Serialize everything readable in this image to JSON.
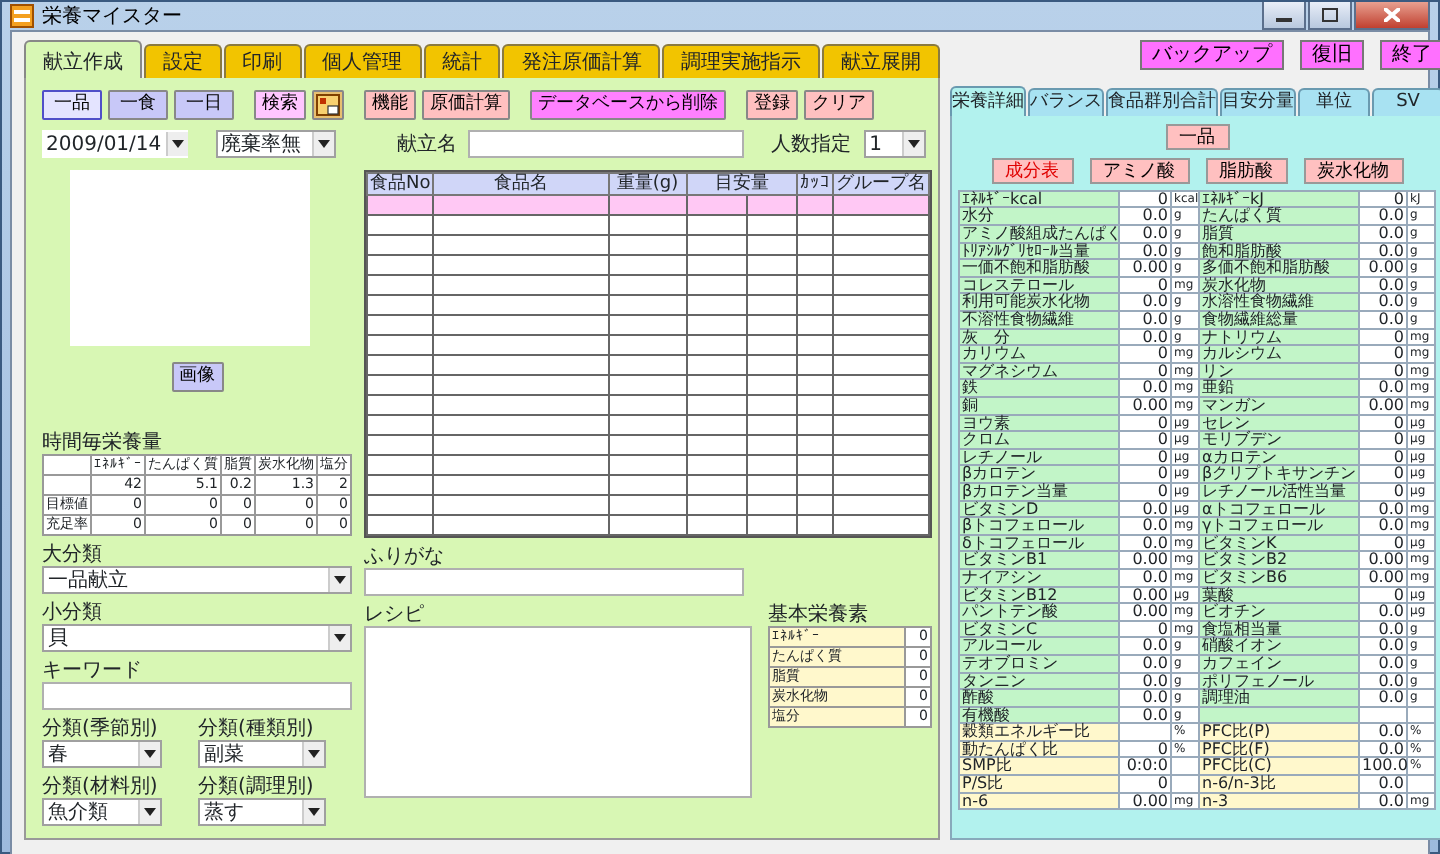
{
  "window": {
    "title": "栄養マイスター"
  },
  "header_buttons": [
    {
      "label": "バックアップ"
    },
    {
      "label": "復旧"
    },
    {
      "label": "終了"
    }
  ],
  "tabs": [
    {
      "label": "献立作成",
      "selected": true
    },
    {
      "label": "設定",
      "selected": false
    },
    {
      "label": "印刷",
      "selected": false
    },
    {
      "label": "個人管理",
      "selected": false
    },
    {
      "label": "統計",
      "selected": false
    },
    {
      "label": "発注原価計算",
      "selected": false
    },
    {
      "label": "調理実施指示",
      "selected": false
    },
    {
      "label": "献立展開",
      "selected": false
    }
  ],
  "meal_modes": [
    {
      "label": "一品",
      "selected": true
    },
    {
      "label": "一食",
      "selected": false
    },
    {
      "label": "一日",
      "selected": false
    }
  ],
  "toolbar_buttons": [
    {
      "kind": "search",
      "label": "検索"
    },
    {
      "kind": "icon"
    },
    {
      "kind": "action",
      "label": "機能"
    },
    {
      "kind": "action",
      "label": "原価計算"
    },
    {
      "kind": "danger",
      "label": "データベースから削除"
    },
    {
      "kind": "save",
      "label": "登録"
    },
    {
      "kind": "save",
      "label": "クリア"
    }
  ],
  "date": {
    "value": "2009/01/14"
  },
  "waste_select": {
    "value": "廃棄率無"
  },
  "menu_name": {
    "label": "献立名"
  },
  "people": {
    "label": "人数指定",
    "value": "1"
  },
  "image_button": {
    "label": "画像"
  },
  "hourly_nutrition": {
    "title": "時間毎栄養量",
    "columns": [
      "ｴﾈﾙｷﾞｰ",
      "たんぱく質",
      "脂質",
      "炭水化物",
      "塩分"
    ],
    "rows": [
      {
        "values": [
          "42",
          "5.1",
          "0.2",
          "1.3",
          "2"
        ]
      },
      {
        "label": "目標値",
        "values": [
          "0",
          "0",
          "0",
          "0",
          "0"
        ]
      },
      {
        "label": "充足率",
        "values": [
          "0",
          "0",
          "0",
          "0",
          "0"
        ]
      }
    ]
  },
  "category_large": {
    "label": "大分類",
    "value": "一品献立"
  },
  "category_small": {
    "label": "小分類",
    "value": "貝"
  },
  "keyword": {
    "label": "キーワード"
  },
  "sub_categories": [
    {
      "label": "分類(季節別)",
      "value": "春"
    },
    {
      "label": "分類(種類別)",
      "value": "副菜"
    },
    {
      "label": "分類(材料別)",
      "value": "魚介類"
    },
    {
      "label": "分類(調理別)",
      "value": "蒸す"
    }
  ],
  "food_table": {
    "columns": [
      {
        "label": "食品No"
      },
      {
        "label": "食品名"
      },
      {
        "label": "重量(g)"
      },
      {
        "label": "目安量",
        "split": true
      },
      {
        "label": "ｶｯｺ"
      },
      {
        "label": "グループ名"
      }
    ]
  },
  "furigana": {
    "label": "ふりがな"
  },
  "recipe": {
    "label": "レシピ"
  },
  "basic_nutrients": {
    "title": "基本栄養素",
    "rows": [
      {
        "name": "ｴﾈﾙｷﾞｰ",
        "value": "0"
      },
      {
        "name": "たんぱく質",
        "value": "0"
      },
      {
        "name": "脂質",
        "value": "0"
      },
      {
        "name": "炭水化物",
        "value": "0"
      },
      {
        "name": "塩分",
        "value": "0"
      }
    ]
  },
  "right_panel": {
    "tabs": [
      {
        "label": "栄養詳細",
        "selected": true
      },
      {
        "label": "バランス",
        "selected": false
      },
      {
        "label": "食品群別合計",
        "selected": false
      },
      {
        "label": "目安分量",
        "selected": false
      },
      {
        "label": "単位",
        "selected": false
      },
      {
        "label": "SV",
        "selected": false
      }
    ],
    "item_button": {
      "label": "一品"
    },
    "view_buttons": [
      {
        "label": "成分表",
        "selected": true
      },
      {
        "label": "アミノ酸",
        "selected": false
      },
      {
        "label": "脂肪酸",
        "selected": false
      },
      {
        "label": "炭水化物",
        "selected": false
      }
    ],
    "nutrient_rows": [
      {
        "kind": "nutrient",
        "cells": [
          {
            "name": "ｴﾈﾙｷﾞｰkcal",
            "value": "0",
            "unit": "kcal"
          },
          {
            "name": "ｴﾈﾙｷﾞｰkJ",
            "value": "0",
            "unit": "kJ"
          }
        ]
      },
      {
        "kind": "nutrient",
        "cells": [
          {
            "name": "水分",
            "value": "0.0",
            "unit": "g"
          },
          {
            "name": "たんぱく質",
            "value": "0.0",
            "unit": "g"
          }
        ]
      },
      {
        "kind": "nutrient",
        "cells": [
          {
            "name": "アミノ酸組成たんぱく",
            "value": "0.0",
            "unit": "g"
          },
          {
            "name": "脂質",
            "value": "0.0",
            "unit": "g"
          }
        ]
      },
      {
        "kind": "nutrient",
        "cells": [
          {
            "name": "ﾄﾘｱｼﾙｸﾞﾘｾﾛｰﾙ当量",
            "value": "0.0",
            "unit": "g"
          },
          {
            "name": "飽和脂肪酸",
            "value": "0.0",
            "unit": "g"
          }
        ]
      },
      {
        "kind": "nutrient",
        "cells": [
          {
            "name": "一価不飽和脂肪酸",
            "value": "0.00",
            "unit": "g"
          },
          {
            "name": "多価不飽和脂肪酸",
            "value": "0.00",
            "unit": "g"
          }
        ]
      },
      {
        "kind": "nutrient",
        "cells": [
          {
            "name": "コレステロール",
            "value": "0",
            "unit": "mg"
          },
          {
            "name": "炭水化物",
            "value": "0.0",
            "unit": "g"
          }
        ]
      },
      {
        "kind": "nutrient",
        "cells": [
          {
            "name": "利用可能炭水化物",
            "value": "0.0",
            "unit": "g"
          },
          {
            "name": "水溶性食物繊維",
            "value": "0.0",
            "unit": "g"
          }
        ]
      },
      {
        "kind": "nutrient",
        "cells": [
          {
            "name": "不溶性食物繊維",
            "value": "0.0",
            "unit": "g"
          },
          {
            "name": "食物繊維総量",
            "value": "0.0",
            "unit": "g"
          }
        ]
      },
      {
        "kind": "nutrient",
        "cells": [
          {
            "name": "灰　分",
            "value": "0.0",
            "unit": "g"
          },
          {
            "name": "ナトリウム",
            "value": "0",
            "unit": "mg"
          }
        ]
      },
      {
        "kind": "nutrient",
        "cells": [
          {
            "name": "カリウム",
            "value": "0",
            "unit": "mg"
          },
          {
            "name": "カルシウム",
            "value": "0",
            "unit": "mg"
          }
        ]
      },
      {
        "kind": "nutrient",
        "cells": [
          {
            "name": "マグネシウム",
            "value": "0",
            "unit": "mg"
          },
          {
            "name": "リン",
            "value": "0",
            "unit": "mg"
          }
        ]
      },
      {
        "kind": "nutrient",
        "cells": [
          {
            "name": "鉄",
            "value": "0.0",
            "unit": "mg"
          },
          {
            "name": "亜鉛",
            "value": "0.0",
            "unit": "mg"
          }
        ]
      },
      {
        "kind": "nutrient",
        "cells": [
          {
            "name": "銅",
            "value": "0.00",
            "unit": "mg"
          },
          {
            "name": "マンガン",
            "value": "0.00",
            "unit": "mg"
          }
        ]
      },
      {
        "kind": "nutrient",
        "cells": [
          {
            "name": "ヨウ素",
            "value": "0",
            "unit": "μg"
          },
          {
            "name": "セレン",
            "value": "0",
            "unit": "μg"
          }
        ]
      },
      {
        "kind": "nutrient",
        "cells": [
          {
            "name": "クロム",
            "value": "0",
            "unit": "μg"
          },
          {
            "name": "モリブデン",
            "value": "0",
            "unit": "μg"
          }
        ]
      },
      {
        "kind": "nutrient",
        "cells": [
          {
            "name": "レチノール",
            "value": "0",
            "unit": "μg"
          },
          {
            "name": "αカロテン",
            "value": "0",
            "unit": "μg"
          }
        ]
      },
      {
        "kind": "nutrient",
        "cells": [
          {
            "name": "βカロテン",
            "value": "0",
            "unit": "μg"
          },
          {
            "name": "βクリプトキサンチン",
            "value": "0",
            "unit": "μg"
          }
        ]
      },
      {
        "kind": "nutrient",
        "cells": [
          {
            "name": "βカロテン当量",
            "value": "0",
            "unit": "μg"
          },
          {
            "name": "レチノール活性当量",
            "value": "0",
            "unit": "μg"
          }
        ]
      },
      {
        "kind": "nutrient",
        "cells": [
          {
            "name": "ビタミンD",
            "value": "0.0",
            "unit": "μg"
          },
          {
            "name": "αトコフェロール",
            "value": "0.0",
            "unit": "mg"
          }
        ]
      },
      {
        "kind": "nutrient",
        "cells": [
          {
            "name": "βトコフェロール",
            "value": "0.0",
            "unit": "mg"
          },
          {
            "name": "γトコフェロール",
            "value": "0.0",
            "unit": "mg"
          }
        ]
      },
      {
        "kind": "nutrient",
        "cells": [
          {
            "name": "δトコフェロール",
            "value": "0.0",
            "unit": "mg"
          },
          {
            "name": "ビタミンK",
            "value": "0",
            "unit": "μg"
          }
        ]
      },
      {
        "kind": "nutrient",
        "cells": [
          {
            "name": "ビタミンB1",
            "value": "0.00",
            "unit": "mg"
          },
          {
            "name": "ビタミンB2",
            "value": "0.00",
            "unit": "mg"
          }
        ]
      },
      {
        "kind": "nutrient",
        "cells": [
          {
            "name": "ナイアシン",
            "value": "0.0",
            "unit": "mg"
          },
          {
            "name": "ビタミンB6",
            "value": "0.00",
            "unit": "mg"
          }
        ]
      },
      {
        "kind": "nutrient",
        "cells": [
          {
            "name": "ビタミンB12",
            "value": "0.00",
            "unit": "μg"
          },
          {
            "name": "葉酸",
            "value": "0",
            "unit": "μg"
          }
        ]
      },
      {
        "kind": "nutrient",
        "cells": [
          {
            "name": "パントテン酸",
            "value": "0.00",
            "unit": "mg"
          },
          {
            "name": "ビオチン",
            "value": "0.0",
            "unit": "μg"
          }
        ]
      },
      {
        "kind": "nutrient",
        "cells": [
          {
            "name": "ビタミンC",
            "value": "0",
            "unit": "mg"
          },
          {
            "name": "食塩相当量",
            "value": "0.0",
            "unit": "g"
          }
        ]
      },
      {
        "kind": "nutrient",
        "cells": [
          {
            "name": "アルコール",
            "value": "0.0",
            "unit": "g"
          },
          {
            "name": "硝酸イオン",
            "value": "0.0",
            "unit": "g"
          }
        ]
      },
      {
        "kind": "nutrient",
        "cells": [
          {
            "name": "テオブロミン",
            "value": "0.0",
            "unit": "g"
          },
          {
            "name": "カフェイン",
            "value": "0.0",
            "unit": "g"
          }
        ]
      },
      {
        "kind": "nutrient",
        "cells": [
          {
            "name": "タンニン",
            "value": "0.0",
            "unit": "g"
          },
          {
            "name": "ポリフェノール",
            "value": "0.0",
            "unit": "g"
          }
        ]
      },
      {
        "kind": "nutrient",
        "cells": [
          {
            "name": "酢酸",
            "value": "0.0",
            "unit": "g"
          },
          {
            "name": "調理油",
            "value": "0.0",
            "unit": "g"
          }
        ]
      },
      {
        "kind": "nutrient",
        "cells": [
          {
            "name": "有機酸",
            "value": "0.0",
            "unit": "g"
          }
        ]
      },
      {
        "kind": "ratio",
        "cells": [
          {
            "name": "穀類エネルギー比",
            "unit": "%"
          },
          {
            "name": "PFC比(P)",
            "value": "0.0",
            "unit": "%"
          }
        ]
      },
      {
        "kind": "ratio",
        "cells": [
          {
            "name": "動たんぱく比",
            "value": "0",
            "unit": "%"
          },
          {
            "name": "PFC比(F)",
            "value": "0.0",
            "unit": "%"
          }
        ]
      },
      {
        "kind": "ratio",
        "cells": [
          {
            "name": "SMP比",
            "value": "0:0:0"
          },
          {
            "name": "PFC比(C)",
            "value": "100.0",
            "unit": "%"
          }
        ]
      },
      {
        "kind": "ratio",
        "cells": [
          {
            "name": "P/S比",
            "value": "0"
          },
          {
            "name": "n-6/n-3比",
            "value": "0.0"
          }
        ]
      },
      {
        "kind": "ratio",
        "cells": [
          {
            "name": "n-6",
            "value": "0.00",
            "unit": "mg"
          },
          {
            "name": "n-3",
            "value": "0.0",
            "unit": "mg"
          }
        ]
      }
    ]
  }
}
